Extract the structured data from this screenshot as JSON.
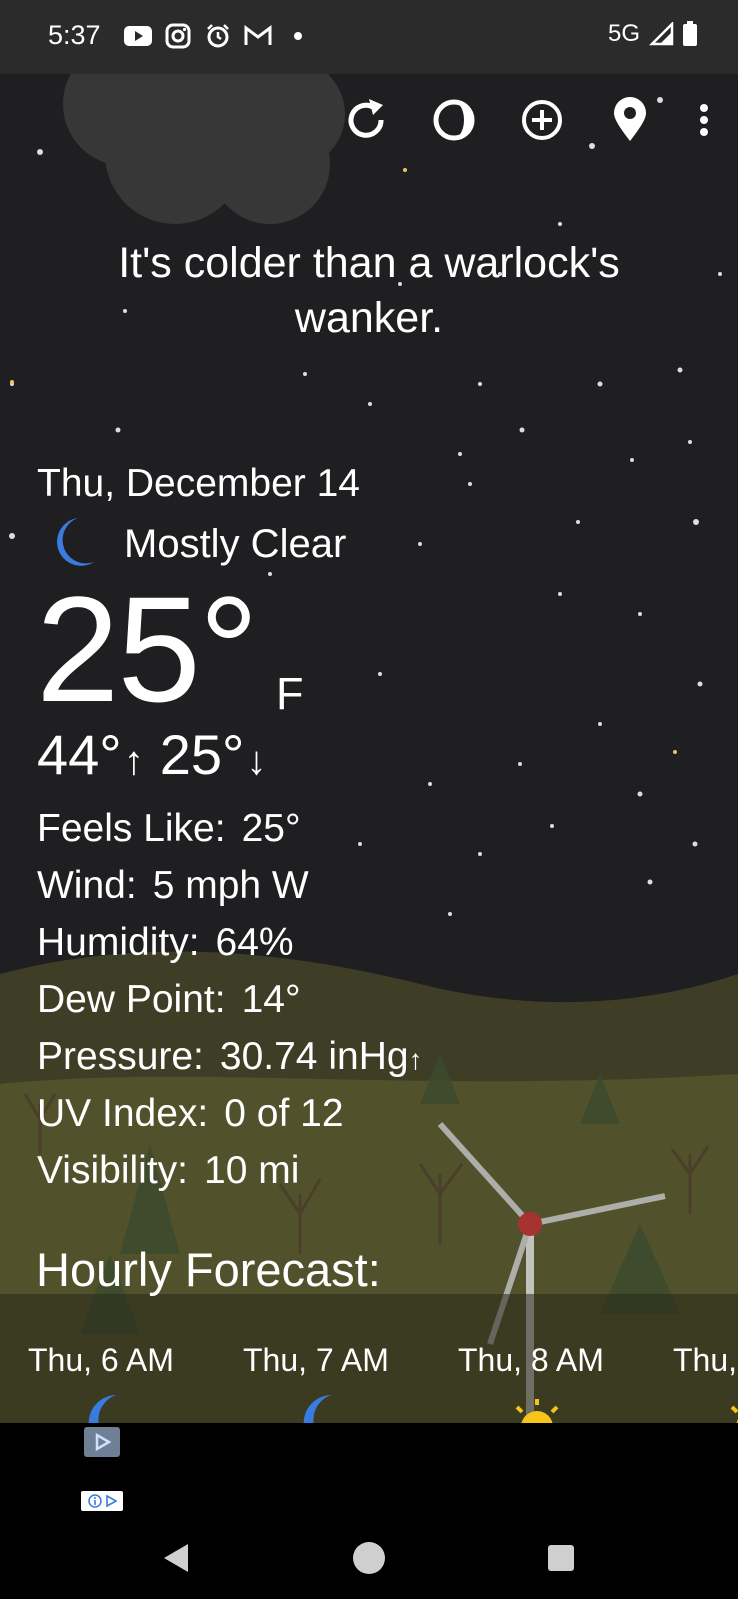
{
  "status_bar": {
    "time": "5:37",
    "icons": [
      "youtube-icon",
      "instagram-icon",
      "alarm-icon",
      "gmail-icon",
      "dot-icon"
    ],
    "network": "5G"
  },
  "toolbar": {
    "icons": [
      "refresh-icon",
      "theme-icon",
      "add-location-icon",
      "location-pin-icon",
      "more-vert-icon"
    ]
  },
  "quip": "It's colder than a warlock's wanker.",
  "current": {
    "date": "Thu, December 14",
    "condition": "Mostly Clear",
    "condition_icon": "moon-icon",
    "temperature": "25°",
    "unit": "F",
    "high": "44°",
    "low": "25°"
  },
  "stats": [
    {
      "label": "Feels Like:",
      "value": "25°"
    },
    {
      "label": "Wind:",
      "value": "5 mph W"
    },
    {
      "label": "Humidity:",
      "value": "64%"
    },
    {
      "label": "Dew Point:",
      "value": "14°"
    },
    {
      "label": "Pressure:",
      "value": "30.74 inHg"
    },
    {
      "label": "UV Index:",
      "value": "0 of 12"
    },
    {
      "label": "Visibility:",
      "value": "10 mi"
    }
  ],
  "hourly": {
    "title": "Hourly Forecast:",
    "items": [
      {
        "time": "Thu, 6 AM",
        "icon": "moon-icon"
      },
      {
        "time": "Thu, 7 AM",
        "icon": "moon-icon"
      },
      {
        "time": "Thu, 8 AM",
        "icon": "sun-icon"
      },
      {
        "time": "Thu,",
        "icon": "sun-icon"
      }
    ]
  },
  "colors": {
    "sky": "#1f1f21",
    "moon": "#3a7be0",
    "sun": "#f5c518",
    "status_bar": "#2b2b2b"
  }
}
